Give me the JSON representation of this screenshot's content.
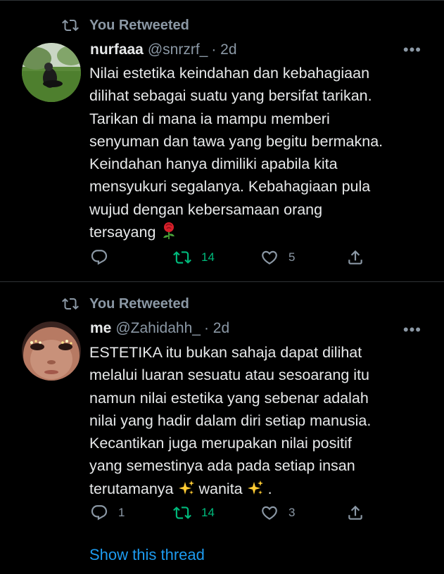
{
  "tweets": [
    {
      "retweet_label": "You Retweeted",
      "name": "nurfaaa",
      "handle": "@snrzrf_",
      "time": "· 2d",
      "more_icon": "more-horizontal-icon",
      "text_lines": [
        "Nilai estetika keindahan dan kebahagiaan",
        "dilihat sebagai suatu yang bersifat tarikan.",
        "Tarikan di mana ia mampu memberi",
        "senyuman dan tawa yang begitu bermakna.",
        "Keindahan hanya dimiliki apabila kita",
        "mensyukuri segalanya. Kebahagiaan pula",
        "wujud dengan kebersamaan  orang",
        "tersayang"
      ],
      "trailing_emoji": "rose",
      "replies": "",
      "retweets": "14",
      "likes": "5",
      "retweeted": true
    },
    {
      "retweet_label": "You Retweeted",
      "name": "me",
      "handle": "@Zahidahh_",
      "time": "· 2d",
      "more_icon": "more-horizontal-icon",
      "text_lines": [
        "ESTETIKA itu bukan sahaja dapat dilihat",
        "melalui luaran sesuatu atau sesoarang itu",
        "namun nilai estetika yang sebenar adalah",
        "nilai yang hadir dalam diri setiap manusia.",
        "Kecantikan juga merupakan nilai positif",
        "yang semestinya ada pada setiap insan"
      ],
      "last_line_parts": [
        "terutamanya",
        "wanita",
        "."
      ],
      "replies": "1",
      "retweets": "14",
      "likes": "3",
      "retweeted": true,
      "show_thread": "Show this thread"
    }
  ],
  "colors": {
    "background": "#000000",
    "text": "#e7e9ea",
    "muted": "#8b98a5",
    "retweet_green": "#00ba7c",
    "link_blue": "#1d9bf0",
    "divider": "#2f3336"
  }
}
